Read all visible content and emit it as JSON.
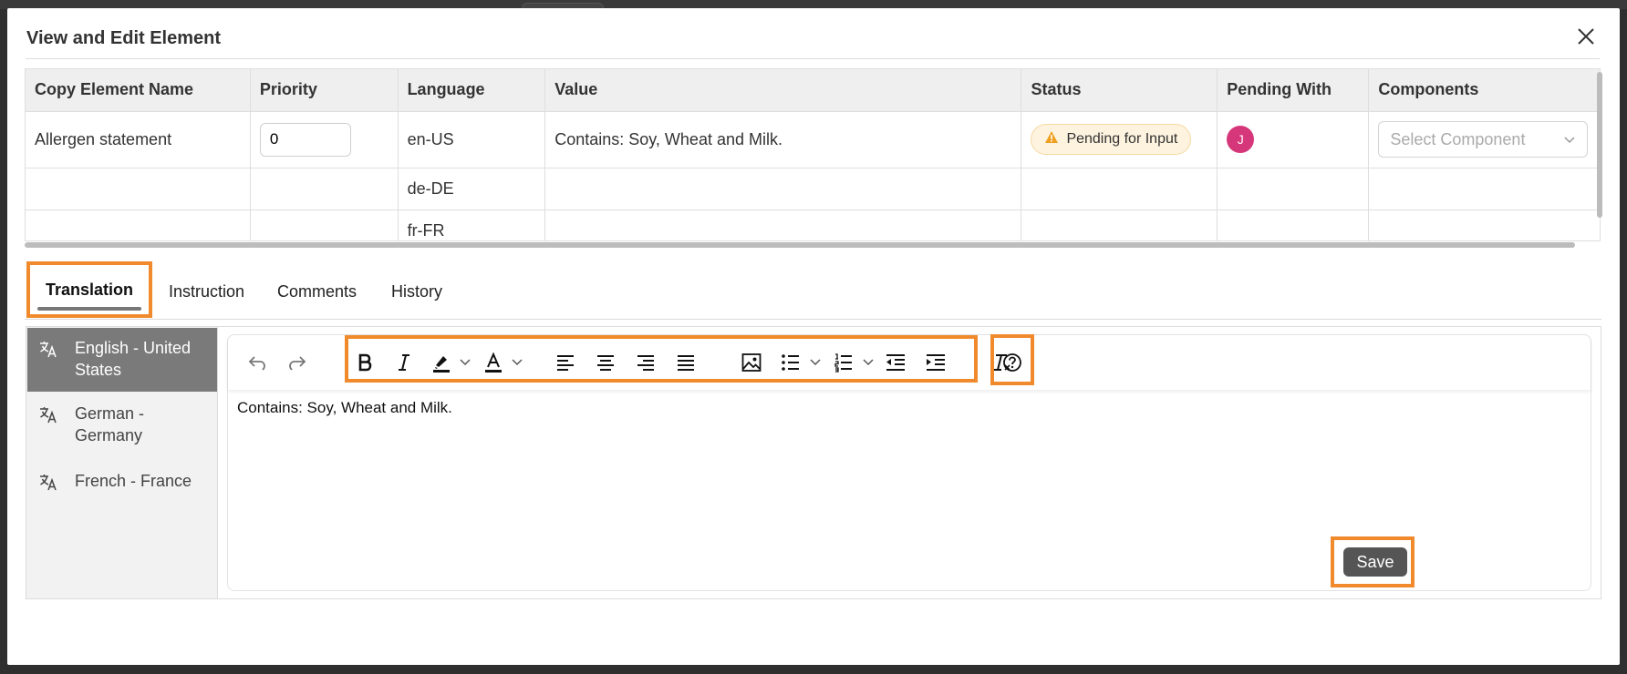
{
  "dialog": {
    "title": "View and Edit Element"
  },
  "table": {
    "headers": [
      "Copy Element Name",
      "Priority",
      "Language",
      "Value",
      "Status",
      "Pending With",
      "Components"
    ],
    "rows": [
      {
        "name": "Allergen statement",
        "priority": "0",
        "language": "en-US",
        "value": "Contains: Soy, Wheat and Milk.",
        "status": "Pending for Input",
        "pending_with_initial": "J",
        "component_placeholder": "Select Component"
      },
      {
        "name": "",
        "language": "de-DE",
        "value": ""
      },
      {
        "name": "",
        "language": "fr-FR",
        "value": ""
      }
    ]
  },
  "tabs": [
    {
      "label": "Translation",
      "active": true
    },
    {
      "label": "Instruction"
    },
    {
      "label": "Comments"
    },
    {
      "label": "History"
    }
  ],
  "languages": [
    {
      "label": "English - United States",
      "active": true
    },
    {
      "label": "German - Germany"
    },
    {
      "label": "French - France"
    }
  ],
  "toolbar": {
    "icons": [
      "undo-icon",
      "redo-icon",
      "bold-icon",
      "italic-icon",
      "highlight-icon",
      "font-color-icon",
      "align-left-icon",
      "align-center-icon",
      "align-right-icon",
      "align-justify-icon",
      "image-icon",
      "bullet-list-icon",
      "numbered-list-icon",
      "outdent-icon",
      "indent-icon",
      "clear-format-icon",
      "help-icon"
    ]
  },
  "editor": {
    "content": "Contains: Soy, Wheat and Milk."
  },
  "footer": {
    "save_label": "Save"
  },
  "colors": {
    "highlight_outline": "#f08a2c",
    "avatar": "#d6377a",
    "status_warning": "#f0a020"
  }
}
